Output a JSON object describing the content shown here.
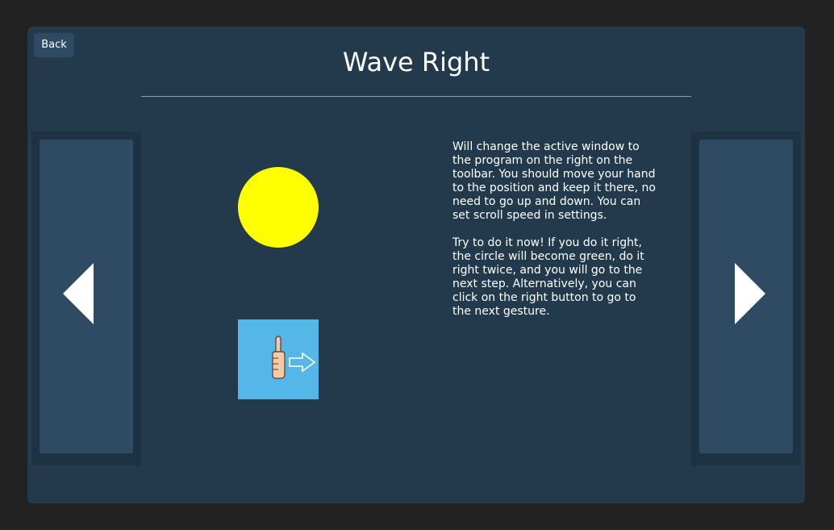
{
  "header": {
    "back_label": "Back",
    "title": "Wave Right"
  },
  "status": {
    "circle_color": "#ffff00"
  },
  "gesture": {
    "icon": "thumbs-up-arrow-right-icon",
    "background_color": "#55b6e8"
  },
  "description": {
    "paragraph_1": "Will change the active window to the program on the right on the toolbar. You should move your hand to the position and keep it there, no need to go up and down. You can set scroll speed in settings.",
    "paragraph_2": "Try to do it now! If you do it right, the circle will become green, do it right twice, and you will go to the next step. Alternatively, you can click on the right button to go to the next gesture."
  },
  "navigation": {
    "previous_icon": "triangle-left-icon",
    "next_icon": "triangle-right-icon"
  }
}
